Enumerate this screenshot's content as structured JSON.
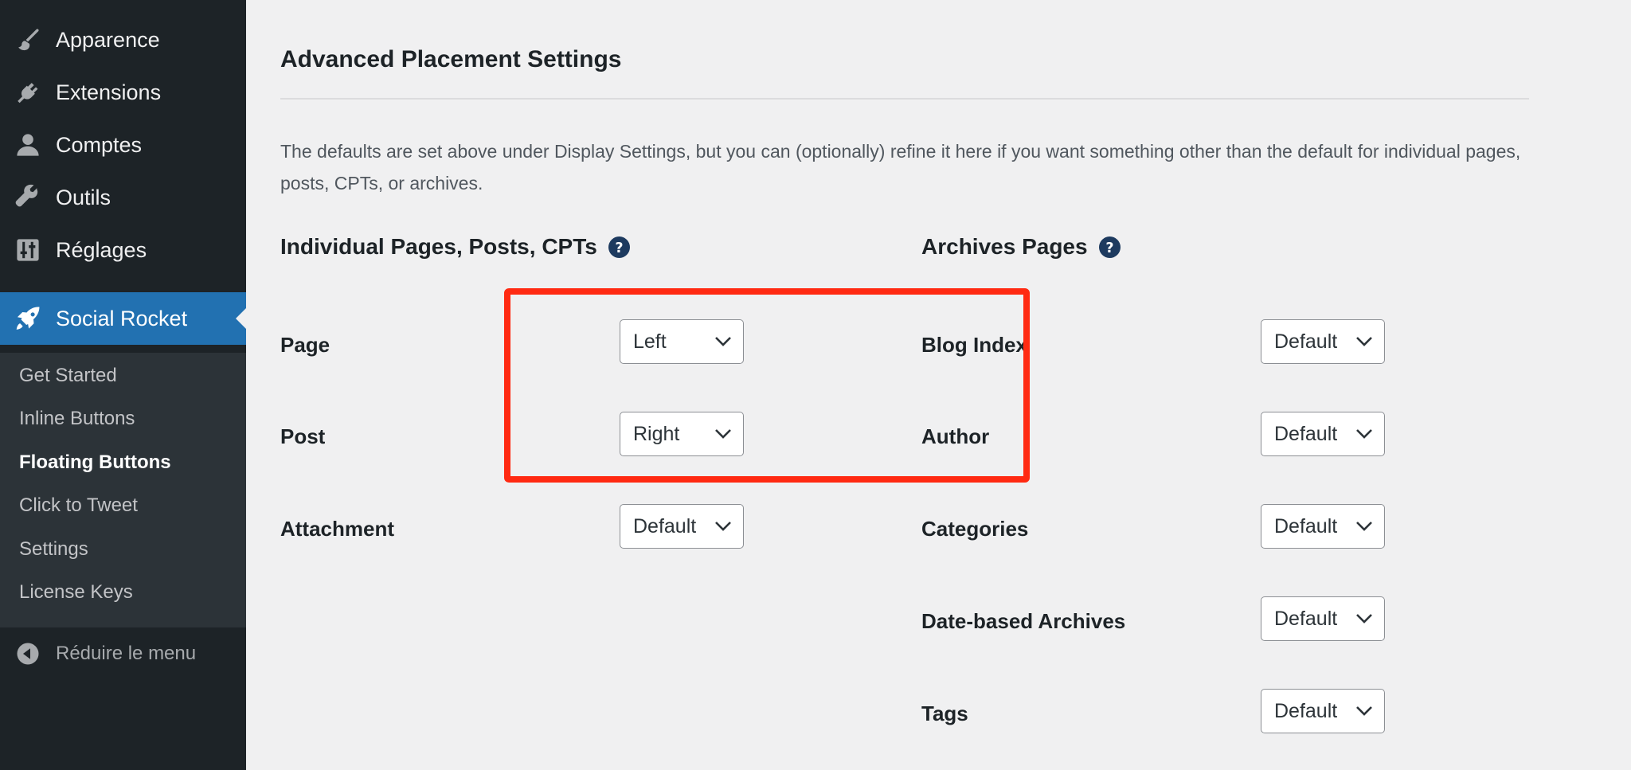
{
  "sidebar": {
    "menu": [
      {
        "label": "Apparence",
        "icon": "paintbrush-icon"
      },
      {
        "label": "Extensions",
        "icon": "plugin-icon"
      },
      {
        "label": "Comptes",
        "icon": "user-icon"
      },
      {
        "label": "Outils",
        "icon": "wrench-icon"
      },
      {
        "label": "Réglages",
        "icon": "sliders-icon"
      },
      {
        "label": "Social Rocket",
        "icon": "rocket-icon",
        "active": true
      }
    ],
    "submenu": [
      {
        "label": "Get Started"
      },
      {
        "label": "Inline Buttons"
      },
      {
        "label": "Floating Buttons",
        "current": true
      },
      {
        "label": "Click to Tweet"
      },
      {
        "label": "Settings"
      },
      {
        "label": "License Keys"
      }
    ],
    "collapse_label": "Réduire le menu"
  },
  "content": {
    "title": "Advanced Placement Settings",
    "description": "The defaults are set above under Display Settings, but you can (optionally) refine it here if you want something other than the default for individual pages, posts, CPTs, or archives.",
    "left_column": {
      "title": "Individual Pages, Posts, CPTs",
      "rows": [
        {
          "label": "Page",
          "value": "Left"
        },
        {
          "label": "Post",
          "value": "Right"
        },
        {
          "label": "Attachment",
          "value": "Default"
        }
      ]
    },
    "right_column": {
      "title": "Archives Pages",
      "rows": [
        {
          "label": "Blog Index",
          "value": "Default"
        },
        {
          "label": "Author",
          "value": "Default"
        },
        {
          "label": "Categories",
          "value": "Default"
        },
        {
          "label": "Date-based Archives",
          "value": "Default"
        },
        {
          "label": "Tags",
          "value": "Default"
        }
      ]
    }
  },
  "colors": {
    "sidebar_bg": "#1d2327",
    "submenu_bg": "#2c3338",
    "accent": "#2271b1",
    "highlight": "#ff2a12",
    "help_icon": "#1d3a5f"
  }
}
